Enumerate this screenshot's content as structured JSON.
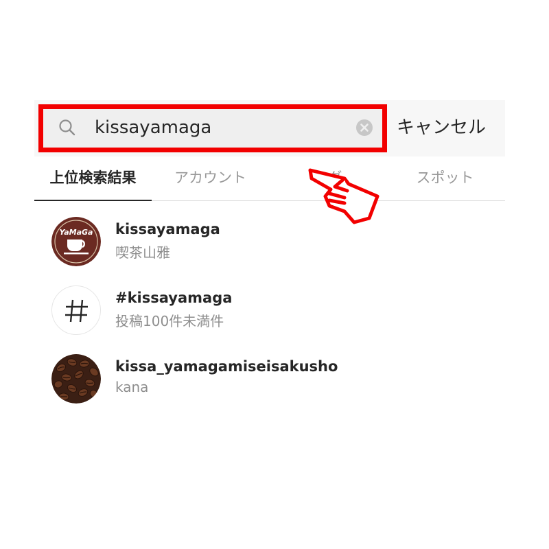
{
  "search": {
    "query": "kissayamaga",
    "cancel_label": "キャンセル"
  },
  "tabs": [
    {
      "label": "上位検索結果",
      "active": true
    },
    {
      "label": "アカウント",
      "active": false
    },
    {
      "label": "タグ",
      "active": false
    },
    {
      "label": "スポット",
      "active": false
    }
  ],
  "results": [
    {
      "title": "kissayamaga",
      "subtitle": "喫茶山雅",
      "avatar": "cafe-logo-icon",
      "logo_text": "YaMaGa"
    },
    {
      "title": "#kissayamaga",
      "subtitle": "投稿100件未満件",
      "avatar": "hashtag-icon",
      "glyph": "#"
    },
    {
      "title": "kissa_yamagamiseisakusho",
      "subtitle": "kana",
      "avatar": "coffee-beans-photo"
    }
  ],
  "colors": {
    "highlight": "#f20000",
    "logo_bg": "#6b2a22"
  }
}
